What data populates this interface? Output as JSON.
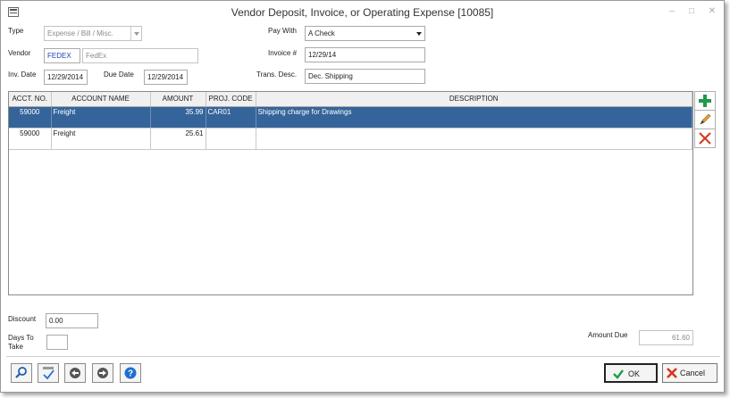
{
  "window": {
    "title": "Vendor Deposit, Invoice, or Operating Expense [10085]"
  },
  "form": {
    "type_label": "Type",
    "type_value": "Expense / Bill / Misc.",
    "vendor_label": "Vendor",
    "vendor_code": "FEDEX",
    "vendor_name": "FedEx",
    "inv_date_label": "Inv. Date",
    "inv_date": "12/29/2014",
    "due_date_label": "Due Date",
    "due_date": "12/29/2014",
    "pay_with_label": "Pay With",
    "pay_with_value": "A Check",
    "invoice_label": "Invoice #",
    "invoice_value": "12/29/14",
    "trans_desc_label": "Trans. Desc.",
    "trans_desc_value": "Dec. Shipping"
  },
  "grid": {
    "columns": [
      "ACCT. NO.",
      "ACCOUNT NAME",
      "AMOUNT",
      "PROJ. CODE",
      "DESCRIPTION"
    ],
    "rows": [
      {
        "acct": "59000",
        "name": "Freight",
        "amount": "35.99",
        "proj": "CAR01",
        "desc": "Shipping charge for Drawings",
        "selected": true
      },
      {
        "acct": "59000",
        "name": "Freight",
        "amount": "25.61",
        "proj": "",
        "desc": "",
        "selected": false
      }
    ]
  },
  "bottom": {
    "discount_label": "Discount",
    "discount_value": "0.00",
    "days_to_take_label": "Days To Take",
    "days_to_take_line1": "Days To",
    "days_to_take_line2": "Take",
    "days_to_take_value": "",
    "amount_due_label": "Amount Due",
    "amount_due_value": "61.60"
  },
  "buttons": {
    "ok_label": "OK",
    "cancel_label": "Cancel"
  },
  "icons": {
    "add": "plus-icon",
    "edit": "pencil-icon",
    "delete": "x-icon",
    "tools": [
      "magnifier-icon",
      "spellcheck-icon",
      "back-arrow-icon",
      "forward-arrow-icon",
      "help-icon"
    ]
  },
  "colors": {
    "selection": "#35649a",
    "add": "#1e9b4a",
    "delete": "#d23a1e",
    "help": "#1e6fd0"
  }
}
